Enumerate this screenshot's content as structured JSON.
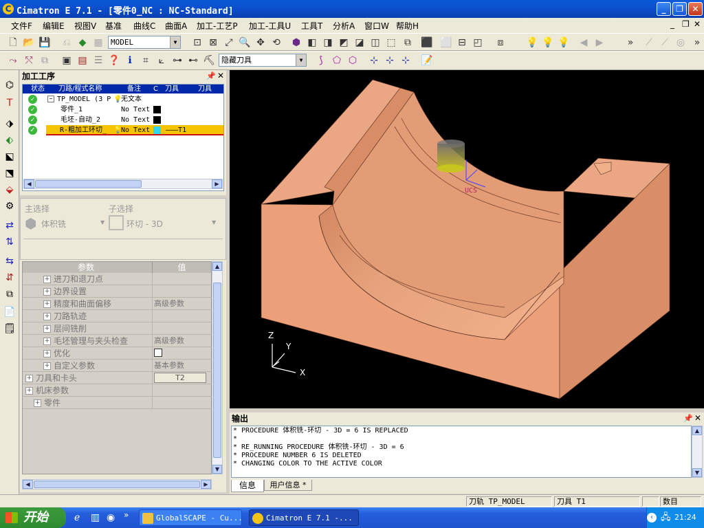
{
  "window": {
    "title": "Cimatron E 7.1 - [零件0_NC : NC-Standard]",
    "min": "_",
    "max": "❐",
    "close": "✕"
  },
  "menubar": [
    "文件F",
    "编辑E",
    "视图V",
    "基准",
    "曲线C",
    "曲面A",
    "加工-工艺P",
    "加工-工具U",
    "工具T",
    "分析A",
    "窗口W",
    "帮助H"
  ],
  "toolbar1": {
    "model_combo": "MODEL"
  },
  "toolbar2": {
    "tool_combo": "隐藏刀具"
  },
  "ops_panel": {
    "title": "加工工序",
    "columns": [
      "状态",
      "刀路/程式名称",
      "备注",
      "C",
      "刀具",
      "刀具"
    ],
    "rows": [
      {
        "name": "TP_MODEL (3 P",
        "note": "无文本",
        "tool": "",
        "color": ""
      },
      {
        "name": "零件_1",
        "note": "No Text",
        "tool": "",
        "color": "#000000"
      },
      {
        "name": "毛坯-自动_2",
        "note": "No Text",
        "tool": "",
        "color": "#000000"
      },
      {
        "name": "R-粗加工环切_",
        "note": "No Text",
        "tool": "———T1",
        "color": "#33d6f0"
      }
    ]
  },
  "selection": {
    "main_label": "主选择",
    "main_value": "体积铣",
    "sub_label": "子选择",
    "sub_value": "环切 - 3D"
  },
  "params": {
    "col_param": "参数",
    "col_value": "值",
    "rows": [
      {
        "label": "进刀和退刀点",
        "value": ""
      },
      {
        "label": "边界设置",
        "value": ""
      },
      {
        "label": "精度和曲面偏移",
        "value": "高级参数"
      },
      {
        "label": "刀路轨迹",
        "value": ""
      },
      {
        "label": "层间铣削",
        "value": ""
      },
      {
        "label": "毛坯管理与夹头检查",
        "value": "高级参数"
      },
      {
        "label": "优化",
        "value": ""
      },
      {
        "label": "自定义参数",
        "value": "基本参数"
      },
      {
        "label": "刀具和卡头",
        "value": "T2"
      },
      {
        "label": "机床参数",
        "value": ""
      },
      {
        "label": "零件",
        "value": ""
      }
    ]
  },
  "viewport": {
    "axis_x": "X",
    "axis_y": "Y",
    "axis_z": "Z",
    "ucs_label": "UCS",
    "part_color": "#e8a07a"
  },
  "output": {
    "title": "输出",
    "lines": [
      "* PROCEDURE 体积铣-环切 - 3D = 6 IS REPLACED",
      "*",
      "* RE_RUNNING PROCEDURE 体积铣-环切 - 3D = 6",
      "* PROCEDURE NUMBER 6 IS DELETED",
      "* CHANGING COLOR TO THE ACTIVE COLOR"
    ],
    "tab1": "信息",
    "tab2": "用户信息 *"
  },
  "status": {
    "toolpath": "刀轨  TP_MODEL",
    "tool": "刀具  T1",
    "count": "数目"
  },
  "taskbar": {
    "start": "开始",
    "task1": "GlobalSCAPE - Cu...",
    "task2": "Cimatron E 7.1 -...",
    "clock": "21:24"
  }
}
